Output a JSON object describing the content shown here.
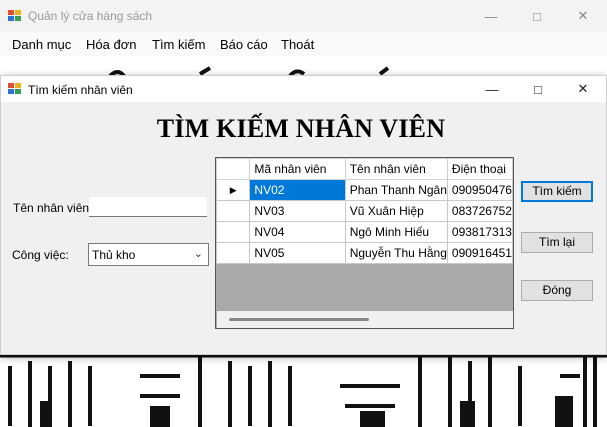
{
  "main_window": {
    "title": "Quản lý cửa hàng sách",
    "menu": [
      "Danh mục",
      "Hóa đơn",
      "Tìm kiếm",
      "Báo cáo",
      "Thoát"
    ]
  },
  "dialog": {
    "title": "Tìm kiếm nhân viên",
    "heading": "TÌM KIẾM NHÂN VIÊN",
    "name_label": "Tên nhân viên:",
    "name_value": "",
    "job_label": "Công việc:",
    "job_value": "Thủ kho",
    "buttons": {
      "search": "Tìm kiếm",
      "reset": "Tìm lại",
      "close": "Đóng"
    },
    "grid": {
      "columns": [
        "Mã nhân viên",
        "Tên nhân viên",
        "Điện thoại"
      ],
      "rows": [
        [
          "NV02",
          "Phan Thanh Ngân",
          "090950476"
        ],
        [
          "NV03",
          "Vũ Xuân Hiệp",
          "083726752"
        ],
        [
          "NV04",
          "Ngô Minh Hiếu",
          "093817313"
        ],
        [
          "NV05",
          "Nguyễn Thu Hằng",
          "090916451"
        ]
      ],
      "selected_row": 0
    }
  },
  "colors": {
    "selection": "#0078d7",
    "dialog_bg": "#f0f0f0",
    "grid_bg": "#a9a9a9"
  }
}
